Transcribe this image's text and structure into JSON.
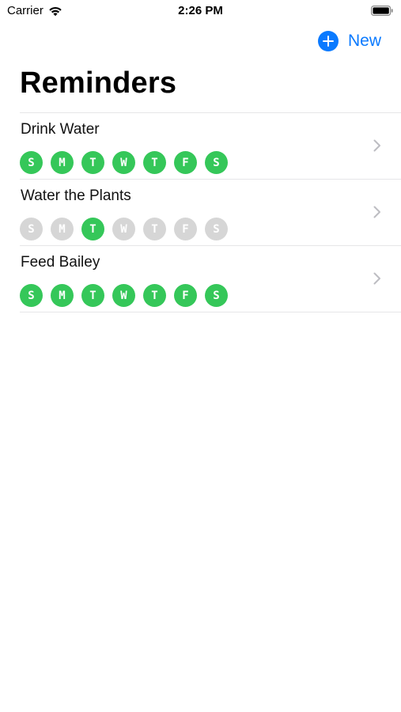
{
  "status_bar": {
    "carrier": "Carrier",
    "time": "2:26 PM"
  },
  "nav": {
    "new_label": "New"
  },
  "page_title": "Reminders",
  "colors": {
    "accent": "#0a7aff",
    "day_on": "#35c759",
    "day_off": "#d6d6d6"
  },
  "reminders": [
    {
      "title": "Drink Water",
      "days": [
        {
          "letter": "S",
          "active": true
        },
        {
          "letter": "M",
          "active": true
        },
        {
          "letter": "T",
          "active": true
        },
        {
          "letter": "W",
          "active": true
        },
        {
          "letter": "T",
          "active": true
        },
        {
          "letter": "F",
          "active": true
        },
        {
          "letter": "S",
          "active": true
        }
      ]
    },
    {
      "title": "Water the Plants",
      "days": [
        {
          "letter": "S",
          "active": false
        },
        {
          "letter": "M",
          "active": false
        },
        {
          "letter": "T",
          "active": true
        },
        {
          "letter": "W",
          "active": false
        },
        {
          "letter": "T",
          "active": false
        },
        {
          "letter": "F",
          "active": false
        },
        {
          "letter": "S",
          "active": false
        }
      ]
    },
    {
      "title": "Feed Bailey",
      "days": [
        {
          "letter": "S",
          "active": true
        },
        {
          "letter": "M",
          "active": true
        },
        {
          "letter": "T",
          "active": true
        },
        {
          "letter": "W",
          "active": true
        },
        {
          "letter": "T",
          "active": true
        },
        {
          "letter": "F",
          "active": true
        },
        {
          "letter": "S",
          "active": true
        }
      ]
    }
  ]
}
